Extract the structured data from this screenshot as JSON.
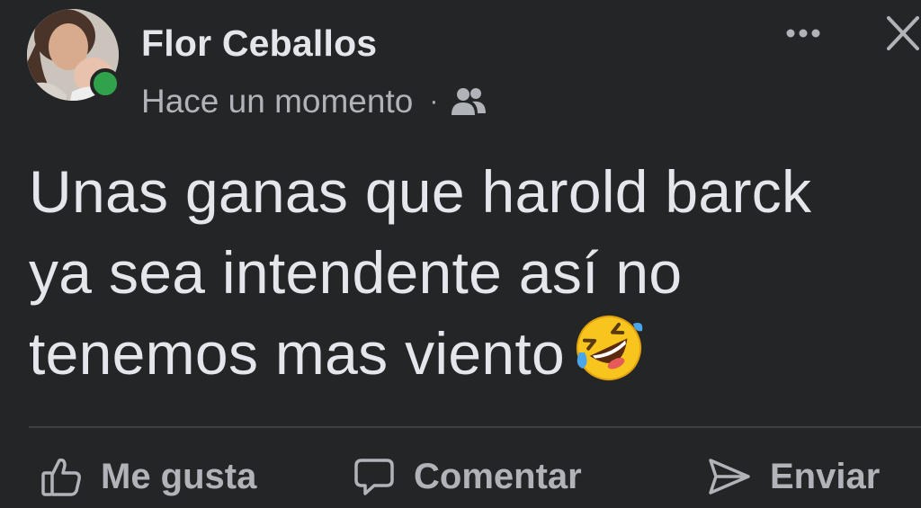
{
  "post": {
    "author": "Flor Ceballos",
    "timestamp": "Hace un momento",
    "separator": "·",
    "audience_icon": "friends-icon",
    "author_online": true,
    "text_lines": [
      "Unas ganas que harold barck",
      "ya sea intendente así no",
      "tenemos mas viento"
    ],
    "emoji": "rolling-on-floor-laughing"
  },
  "header_actions": {
    "more_icon": "more-options-icon",
    "close_icon": "close-icon"
  },
  "actions": {
    "like_label": "Me gusta",
    "comment_label": "Comentar",
    "send_label": "Enviar"
  },
  "colors": {
    "background": "#242526",
    "primary_text": "#e4e6eb",
    "secondary_text": "#b0b3b8",
    "online": "#31a24c",
    "divider": "#3e4042"
  }
}
